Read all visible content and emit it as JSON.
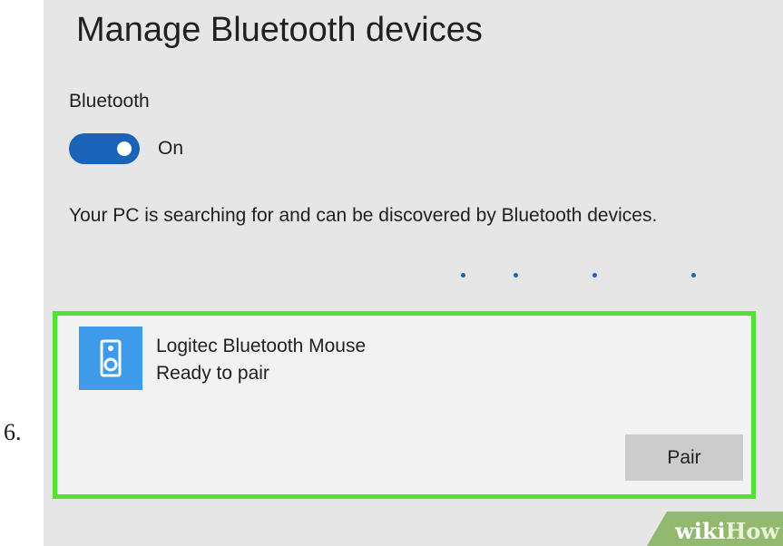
{
  "step_number": "6.",
  "header": {
    "title": "Manage Bluetooth devices"
  },
  "bluetooth": {
    "label": "Bluetooth",
    "toggle_state": "On",
    "toggle_on": true,
    "toggle_color": "#1a63b8"
  },
  "status_message": "Your PC is searching for and can be discovered by Bluetooth devices.",
  "device": {
    "name": "Logitec Bluetooth Mouse",
    "status": "Ready to pair",
    "icon": "speaker-icon",
    "icon_color": "#3d9be9",
    "pair_label": "Pair",
    "highlight_color": "#52e234"
  },
  "watermark": {
    "part1": "wiki",
    "part2": "How"
  }
}
